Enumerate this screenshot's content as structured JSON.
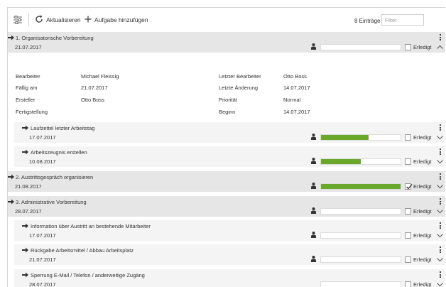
{
  "toolbar": {
    "settings_icon": "settings-sliders-icon",
    "refresh_label": "Aktualisieren",
    "add_label": "Aufgabe hinzufügen",
    "count_label": "8 Einträge",
    "filter_placeholder": "Filter",
    "filter_value": ""
  },
  "colors": {
    "progress": "#69a82b",
    "row_top": "#e6e6e6",
    "row_sub": "#f4f4f4"
  },
  "tasks": [
    {
      "title": "1. Organisatorische Vorbereitung",
      "date": "21.07.2017",
      "progress": 0,
      "done": false,
      "done_label": "Erledigt",
      "expanded": true,
      "level": 0
    },
    {
      "title": "Laufzettel letzter Arbeitstag",
      "date": "17.07.2017",
      "progress": 0.6,
      "done": false,
      "done_label": "Erledigt",
      "expanded": false,
      "level": 1
    },
    {
      "title": "Arbeitszeugnis erstellen",
      "date": "10.08.2017",
      "progress": 0.5,
      "done": false,
      "done_label": "Erledigt",
      "expanded": false,
      "level": 1
    },
    {
      "title": "2. Austrittsgespräch organisieren",
      "date": "21.08.2017",
      "progress": 1.0,
      "done": true,
      "done_label": "Erledigt",
      "expanded": false,
      "level": 0
    },
    {
      "title": "3. Administrative Vorbereitung",
      "date": "28.07.2017",
      "progress": 0,
      "done": false,
      "done_label": "Erledigt",
      "expanded": false,
      "level": 0
    },
    {
      "title": "Information über Austritt an bestehende Mitarbeiter",
      "date": "17.07.2017",
      "progress": 0,
      "done": false,
      "done_label": "Erledigt",
      "expanded": false,
      "level": 1
    },
    {
      "title": "Rückgabe Arbeitsmittel / Abbau Arbeitsplatz",
      "date": "21.07.2017",
      "progress": 0,
      "done": false,
      "done_label": "Erledigt",
      "expanded": false,
      "level": 1
    },
    {
      "title": "Sperrung E-Mail / Telefon / anderweitige Zugäng",
      "date": "28.07.2017",
      "progress": 0,
      "done": false,
      "done_label": "Erledigt",
      "expanded": false,
      "level": 1
    }
  ],
  "details": {
    "left": [
      {
        "label": "Bearbeiter",
        "value": "Michael Fleissig"
      },
      {
        "label": "Fällig am",
        "value": "21.07.2017"
      },
      {
        "label": "Ersteller",
        "value": "Otto Boss"
      },
      {
        "label": "Fertigstellung",
        "value": ""
      }
    ],
    "right": [
      {
        "label": "Letzter Bearbeiter",
        "value": "Otto Boss"
      },
      {
        "label": "Letzte Änderung",
        "value": "14.07.2017"
      },
      {
        "label": "Priorität",
        "value": "Normal"
      },
      {
        "label": "Beginn",
        "value": "14.07.2017"
      }
    ]
  }
}
